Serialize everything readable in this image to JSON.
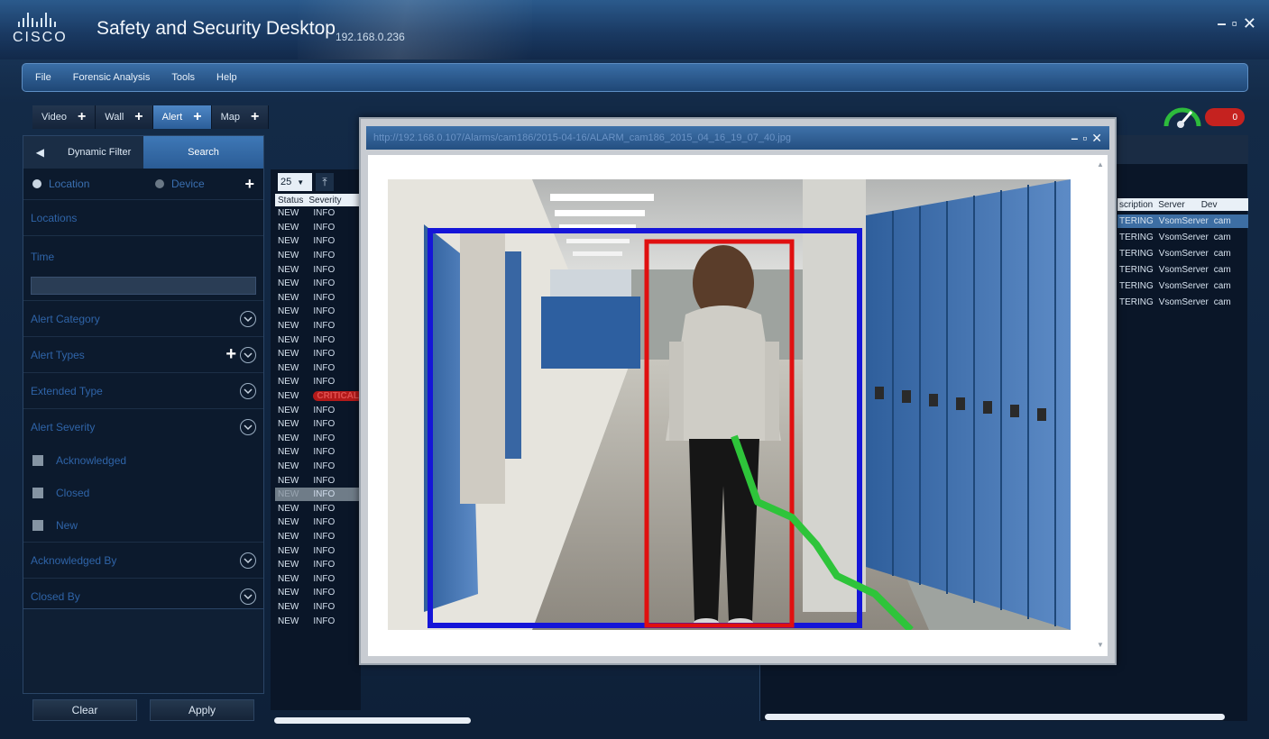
{
  "app": {
    "title": "Safety and Security Desktop",
    "ip": "192.168.0.236",
    "logo_text": "CISCO"
  },
  "window_controls": [
    "–",
    "▫",
    "✕"
  ],
  "menu": [
    "File",
    "Forensic Analysis",
    "Tools",
    "Help"
  ],
  "top_tabs": [
    {
      "label": "Video",
      "active": false
    },
    {
      "label": "Wall",
      "active": false
    },
    {
      "label": "Alert",
      "active": true
    },
    {
      "label": "Map",
      "active": false
    }
  ],
  "toggle": {
    "label": "0",
    "color": "#c5221f"
  },
  "left_panel": {
    "tabs": [
      {
        "label": "Dynamic Filter",
        "active": false
      },
      {
        "label": "Search",
        "active": true
      }
    ],
    "radio": [
      {
        "label": "Location",
        "checked": true
      },
      {
        "label": "Device",
        "checked": false
      }
    ],
    "filters": {
      "locations": "Locations",
      "time": "Time",
      "alert_category": "Alert Category",
      "alert_types": "Alert Types",
      "extended_type": "Extended Type",
      "alert_severity": "Alert Severity",
      "acknowledged": "Acknowledged",
      "closed": "Closed",
      "new": "New",
      "acknowledged_by": "Acknowledged By",
      "closed_by": "Closed By"
    },
    "buttons": {
      "clear": "Clear",
      "apply": "Apply"
    }
  },
  "alert_list": {
    "page_size": "25",
    "columns": [
      "Status",
      "Severity"
    ],
    "rows": [
      {
        "status": "NEW",
        "severity": "INFO",
        "state": "normal"
      },
      {
        "status": "NEW",
        "severity": "INFO",
        "state": "normal"
      },
      {
        "status": "NEW",
        "severity": "INFO",
        "state": "normal"
      },
      {
        "status": "NEW",
        "severity": "INFO",
        "state": "normal"
      },
      {
        "status": "NEW",
        "severity": "INFO",
        "state": "normal"
      },
      {
        "status": "NEW",
        "severity": "INFO",
        "state": "normal"
      },
      {
        "status": "NEW",
        "severity": "INFO",
        "state": "normal"
      },
      {
        "status": "NEW",
        "severity": "INFO",
        "state": "normal"
      },
      {
        "status": "NEW",
        "severity": "INFO",
        "state": "normal"
      },
      {
        "status": "NEW",
        "severity": "INFO",
        "state": "normal"
      },
      {
        "status": "NEW",
        "severity": "INFO",
        "state": "normal"
      },
      {
        "status": "NEW",
        "severity": "INFO",
        "state": "normal"
      },
      {
        "status": "NEW",
        "severity": "INFO",
        "state": "normal"
      },
      {
        "status": "NEW",
        "severity": "CRITICAL",
        "state": "critical"
      },
      {
        "status": "NEW",
        "severity": "INFO",
        "state": "normal"
      },
      {
        "status": "NEW",
        "severity": "INFO",
        "state": "normal"
      },
      {
        "status": "NEW",
        "severity": "INFO",
        "state": "normal"
      },
      {
        "status": "NEW",
        "severity": "INFO",
        "state": "normal"
      },
      {
        "status": "NEW",
        "severity": "INFO",
        "state": "normal"
      },
      {
        "status": "NEW",
        "severity": "INFO",
        "state": "normal"
      },
      {
        "status": "NEW",
        "severity": "INFO",
        "state": "selected"
      },
      {
        "status": "NEW",
        "severity": "INFO",
        "state": "normal"
      },
      {
        "status": "NEW",
        "severity": "INFO",
        "state": "normal"
      },
      {
        "status": "NEW",
        "severity": "INFO",
        "state": "normal"
      },
      {
        "status": "NEW",
        "severity": "INFO",
        "state": "normal"
      },
      {
        "status": "NEW",
        "severity": "INFO",
        "state": "normal"
      },
      {
        "status": "NEW",
        "severity": "INFO",
        "state": "normal"
      },
      {
        "status": "NEW",
        "severity": "INFO",
        "state": "normal"
      },
      {
        "status": "NEW",
        "severity": "INFO",
        "state": "normal"
      },
      {
        "status": "NEW",
        "severity": "INFO",
        "state": "normal"
      }
    ]
  },
  "event_list": {
    "columns": [
      "scription",
      "Server",
      "Dev"
    ],
    "rows": [
      {
        "description": "TERING",
        "server": "VsomServer",
        "device": "cam",
        "selected": true
      },
      {
        "description": "TERING",
        "server": "VsomServer",
        "device": "cam",
        "selected": false
      },
      {
        "description": "TERING",
        "server": "VsomServer",
        "device": "cam",
        "selected": false
      },
      {
        "description": "TERING",
        "server": "VsomServer",
        "device": "cam",
        "selected": false
      },
      {
        "description": "TERING",
        "server": "VsomServer",
        "device": "cam",
        "selected": false
      },
      {
        "description": "TERING",
        "server": "VsomServer",
        "device": "cam",
        "selected": false
      },
      {
        "description": "TERING",
        "server": "VsomServer",
        "device": "cam",
        "selected": false
      },
      {
        "description": "TERING",
        "server": "VsomServer",
        "device": "cam",
        "selected": false
      }
    ]
  },
  "popup": {
    "url": "http://192.168.0.107/Alarms/cam186/2015-04-16/ALARM_cam186_2015_04_16_19_07_40.jpg",
    "colors": {
      "outer_box": "#1515d8",
      "inner_box": "#e01010",
      "track": "#2ec43a"
    }
  }
}
